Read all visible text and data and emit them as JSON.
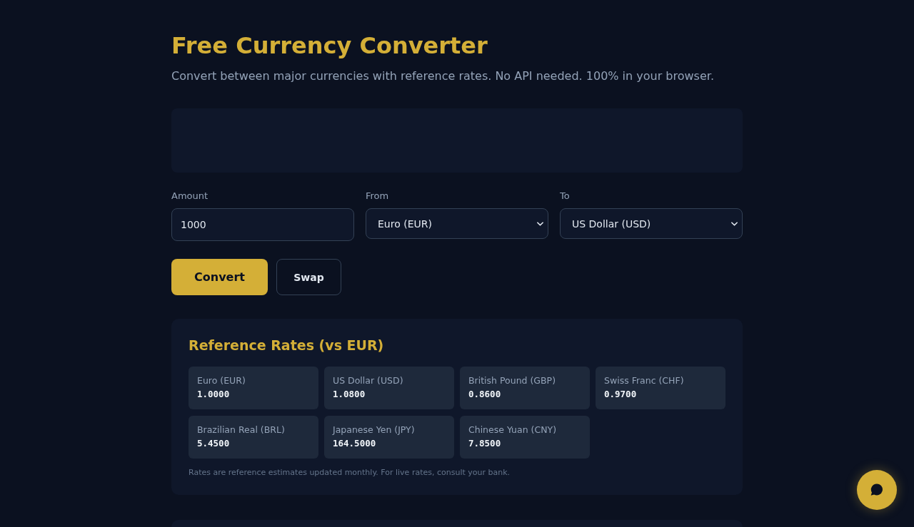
{
  "header": {
    "title": "Free Currency Converter",
    "subtitle": "Convert between major currencies with reference rates. No API needed. 100% in your browser."
  },
  "converter": {
    "amount": {
      "label": "Amount",
      "value": "1000"
    },
    "from": {
      "label": "From",
      "value": "Euro (EUR)"
    },
    "to": {
      "label": "To",
      "value": "US Dollar (USD)"
    },
    "buttons": [
      {
        "label": "Convert",
        "kind": "primary"
      },
      {
        "label": "Swap",
        "kind": "secondary"
      }
    ]
  },
  "rates": {
    "title": "Reference Rates (vs EUR)",
    "items": [
      {
        "name": "Euro (EUR)",
        "rate": "1.0000"
      },
      {
        "name": "US Dollar (USD)",
        "rate": "1.0800"
      },
      {
        "name": "British Pound (GBP)",
        "rate": "0.8600"
      },
      {
        "name": "Swiss Franc (CHF)",
        "rate": "0.9700"
      },
      {
        "name": "Brazilian Real (BRL)",
        "rate": "5.4500"
      },
      {
        "name": "Japanese Yen (JPY)",
        "rate": "164.5000"
      },
      {
        "name": "Chinese Yuan (CNY)",
        "rate": "7.8500"
      }
    ],
    "note": "Rates are reference estimates updated monthly. For live rates, consult your bank."
  }
}
